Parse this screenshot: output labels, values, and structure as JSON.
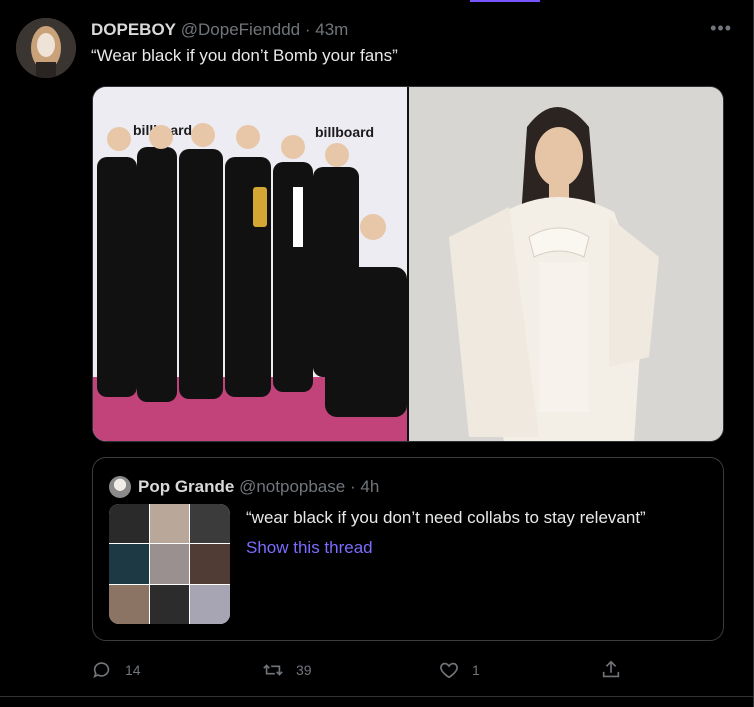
{
  "tweet": {
    "display_name": "DOPEBOY",
    "handle": "@DopeFienddd",
    "separator": "·",
    "time": "43m",
    "text": "“Wear black if you don’t Bomb your fans”",
    "more": "•••",
    "media": [
      {
        "label": "billboard",
        "alt_caption": "group photo"
      },
      {
        "label": "",
        "alt_caption": "portrait"
      }
    ]
  },
  "quote": {
    "display_name": "Pop Grande",
    "handle": "@notpopbase",
    "separator": "·",
    "time": "4h",
    "text": "“wear black if you don’t need collabs to stay relevant”",
    "show_thread": "Show this thread"
  },
  "actions": {
    "reply_count": "14",
    "retweet_count": "39",
    "like_count": "1"
  },
  "colors": {
    "accent": "#7856ff",
    "link": "#7c6cff",
    "muted": "#71767b",
    "background": "#000000"
  }
}
